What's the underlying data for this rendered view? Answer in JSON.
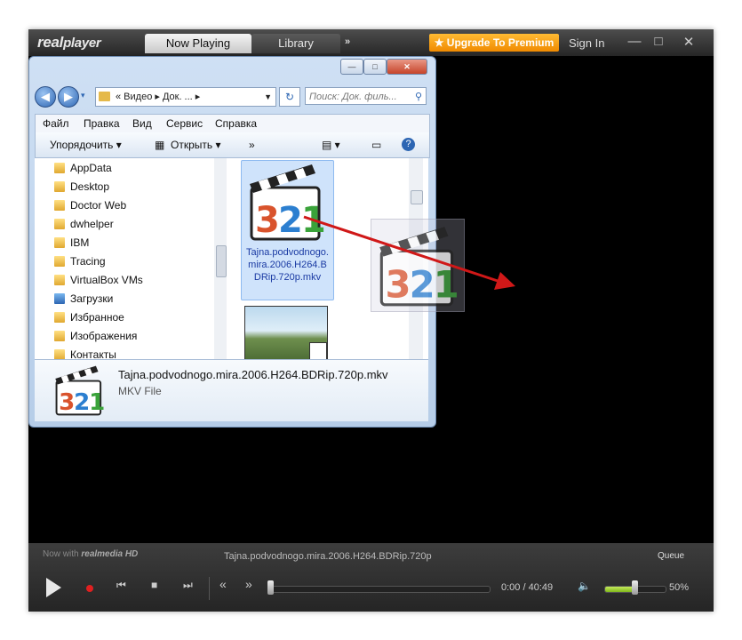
{
  "player": {
    "logo": {
      "prefix": "real",
      "suffix": "player"
    },
    "tabs": {
      "now_playing": "Now Playing",
      "library": "Library"
    },
    "more": "»",
    "upgrade": "★ Upgrade To Premium",
    "sign_in": "Sign In",
    "window": {
      "minimize": "—",
      "maximize": "□",
      "close": "✕"
    },
    "now_with": {
      "label": "Now with",
      "brand": "realmedia HD"
    },
    "track": "Tajna.podvodnogo.mira.2006.H264.BDRip.720p",
    "queue": "Queue",
    "time": "0:00 / 40:49",
    "volume_pct": "50%",
    "volume_value": 0.5,
    "seek_value": 0.0,
    "controls": {
      "prev": "⏮",
      "stop": "■",
      "next": "⏭",
      "rewind": "«",
      "ffwd": "»",
      "mute": "🔈"
    }
  },
  "explorer": {
    "window": {
      "minimize": "—",
      "maximize": "□",
      "close": "✕"
    },
    "breadcrumb": "«  Видео  ▸ Док. ...  ▸",
    "refresh": "↻",
    "search_placeholder": "Поиск: Док. филь...",
    "menu": [
      "Файл",
      "Правка",
      "Вид",
      "Сервис",
      "Справка"
    ],
    "toolbar": {
      "organize": "Упорядочить ▾",
      "open": "Открыть ▾",
      "more": "»"
    },
    "tree": [
      "AppData",
      "Desktop",
      "Doctor Web",
      "dwhelper",
      "IBM",
      "Tracing",
      "VirtualBox VMs",
      "Загрузки",
      "Избранное",
      "Изображения",
      "Контакты"
    ],
    "selected_file_label": "Tajna.podvodnogo.mira.2006.H264.BDRip.720p.mkv",
    "details": {
      "name": "Tajna.podvodnogo.mira.2006.H264.BDRip.720p.mkv",
      "type": "MKV File"
    },
    "icon_digits": [
      "3",
      "2",
      "1"
    ]
  },
  "colors": {
    "upgrade": "#f59a0a",
    "volume": "#9acd32",
    "drag_arrow": "#d01818",
    "digit3": "#d9532c",
    "digit2": "#2c7fd0",
    "digit1": "#3aa33a"
  }
}
